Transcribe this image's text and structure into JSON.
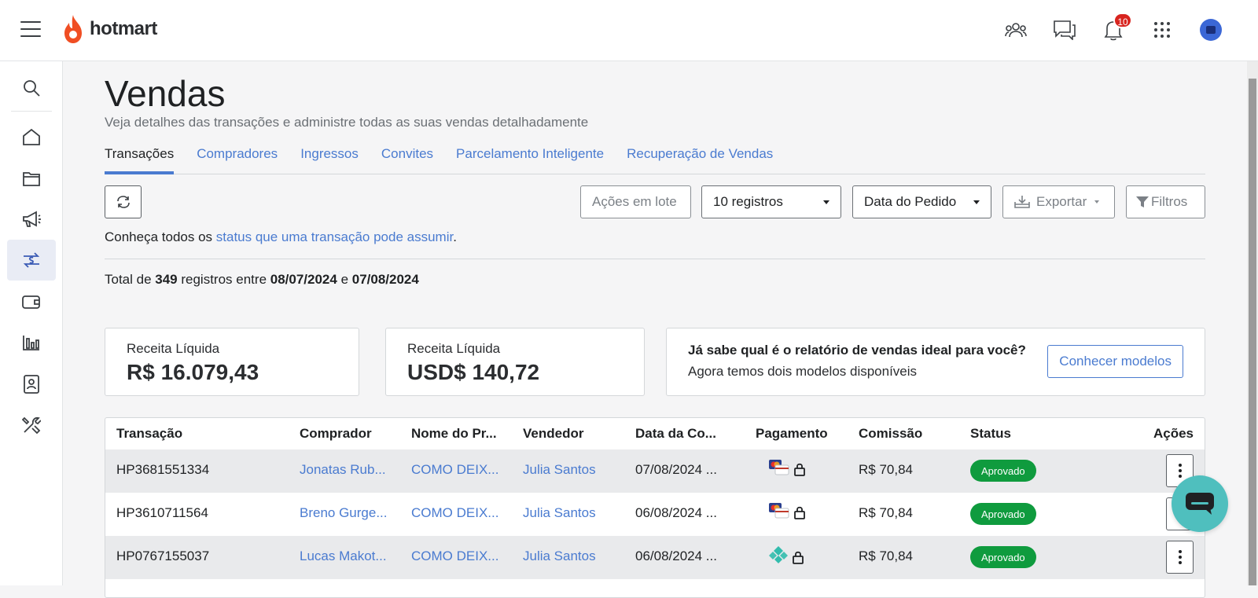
{
  "header": {
    "brand": "hotmart",
    "notification_count": "10",
    "icons": [
      "menu-icon",
      "people-icon",
      "chat-icon",
      "bell-icon",
      "apps-grid-icon",
      "avatar"
    ]
  },
  "sidebar": {
    "items": [
      {
        "icon": "search-icon"
      },
      {
        "icon": "home-icon"
      },
      {
        "icon": "folder-icon"
      },
      {
        "icon": "megaphone-icon"
      },
      {
        "icon": "sales-icon",
        "active": true
      },
      {
        "icon": "wallet-icon"
      },
      {
        "icon": "bar-chart-icon"
      },
      {
        "icon": "contact-card-icon"
      },
      {
        "icon": "tools-icon"
      }
    ]
  },
  "page": {
    "title": "Vendas",
    "subtitle": "Veja detalhes das transações e administre todas as suas vendas detalhadamente"
  },
  "tabs": [
    {
      "label": "Transações",
      "active": true
    },
    {
      "label": "Compradores"
    },
    {
      "label": "Ingressos"
    },
    {
      "label": "Convites"
    },
    {
      "label": "Parcelamento Inteligente"
    },
    {
      "label": "Recuperação de Vendas"
    }
  ],
  "toolbar": {
    "bulk_actions": "Ações em lote",
    "page_size": "10 registros",
    "sort_by": "Data do Pedido",
    "export": "Exportar",
    "filters": "Filtros"
  },
  "status_info": {
    "prefix": "Conheça todos os ",
    "link": "status que uma transação pode assumir",
    "suffix": "."
  },
  "totals": {
    "prefix": "Total de ",
    "count": "349",
    "middle": " registros entre ",
    "start_date": "08/07/2024",
    "conj": " e ",
    "end_date": "07/08/2024"
  },
  "cards": [
    {
      "label": "Receita Líquida",
      "value": "R$ 16.079,43"
    },
    {
      "label": "Receita Líquida",
      "value": "USD$ 140,72"
    }
  ],
  "promo": {
    "title": "Já sabe qual é o relatório de vendas ideal para você?",
    "subtitle": "Agora temos dois modelos disponíveis",
    "button": "Conhecer modelos"
  },
  "table": {
    "headers": [
      "Transação",
      "Comprador",
      "Nome do Pr...",
      "Vendedor",
      "Data da Co...",
      "Pagamento",
      "Comissão",
      "Status",
      "Ações"
    ],
    "rows": [
      {
        "transaction": "HP3681551334",
        "buyer": "Jonatas Rub...",
        "product": "COMO DEIX...",
        "seller": "Julia Santos",
        "date": "07/08/2024 ...",
        "payment": "card",
        "commission": "R$ 70,84",
        "status": "Aprovado"
      },
      {
        "transaction": "HP3610711564",
        "buyer": "Breno Gurge...",
        "product": "COMO DEIX...",
        "seller": "Julia Santos",
        "date": "06/08/2024 ...",
        "payment": "card",
        "commission": "R$ 70,84",
        "status": "Aprovado"
      },
      {
        "transaction": "HP0767155037",
        "buyer": "Lucas Makot...",
        "product": "COMO DEIX...",
        "seller": "Julia Santos",
        "date": "06/08/2024 ...",
        "payment": "pix",
        "commission": "R$ 70,84",
        "status": "Aprovado"
      }
    ]
  },
  "colors": {
    "accent": "#4a7bd0",
    "brand": "#f04e23",
    "status_approved": "#0f9b3e",
    "chat_fab": "#4fbfbe"
  }
}
